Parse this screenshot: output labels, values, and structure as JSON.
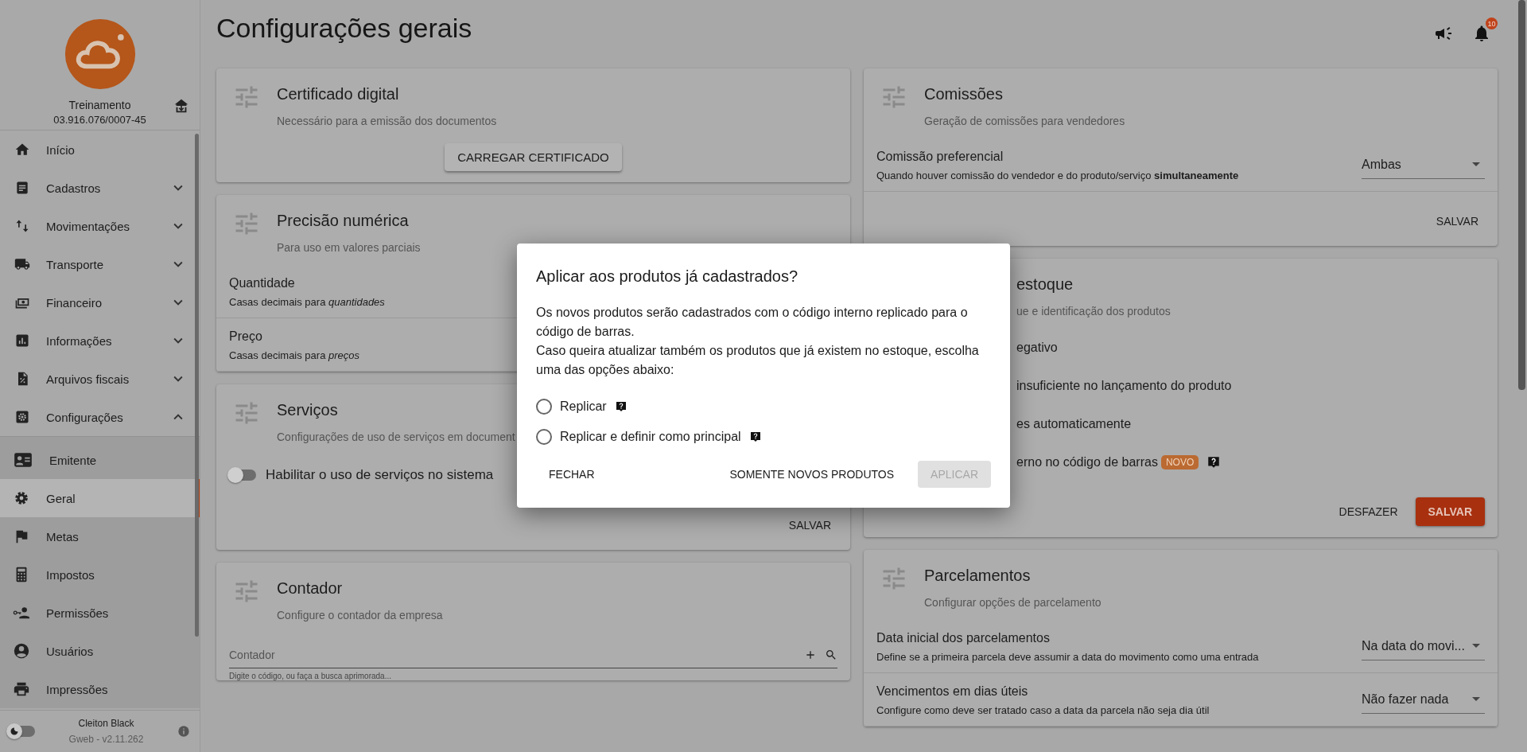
{
  "sidebar": {
    "company": {
      "name": "Treinamento",
      "id": "03.916.076/0007-45"
    },
    "items": [
      {
        "label": "Início",
        "kind": "link"
      },
      {
        "label": "Cadastros",
        "kind": "group",
        "expanded": false
      },
      {
        "label": "Movimentações",
        "kind": "group",
        "expanded": false
      },
      {
        "label": "Transporte",
        "kind": "group",
        "expanded": false
      },
      {
        "label": "Financeiro",
        "kind": "group",
        "expanded": false
      },
      {
        "label": "Informações",
        "kind": "group",
        "expanded": false
      },
      {
        "label": "Arquivos fiscais",
        "kind": "group",
        "expanded": false
      },
      {
        "label": "Configurações",
        "kind": "group",
        "expanded": true,
        "children": [
          {
            "label": "Emitente",
            "selected": false
          },
          {
            "label": "Geral",
            "selected": true
          },
          {
            "label": "Metas",
            "selected": false
          },
          {
            "label": "Impostos",
            "selected": false
          },
          {
            "label": "Permissões",
            "selected": false
          },
          {
            "label": "Usuários",
            "selected": false
          },
          {
            "label": "Impressões",
            "selected": false
          }
        ]
      }
    ],
    "footer": {
      "dark_mode": false,
      "user": "Cleiton Black",
      "version": "Gweb - v2.11.262"
    }
  },
  "header": {
    "title": "Configurações gerais",
    "notifications": "10"
  },
  "columns": [
    [
      {
        "title": "Certificado digital",
        "subtitle": "Necessário para a emissão dos documentos",
        "body": [
          {
            "kind": "button",
            "label": "CARREGAR CERTIFICADO"
          }
        ]
      },
      {
        "title": "Precisão numérica",
        "subtitle": "Para uso em valores parciais",
        "body": [
          {
            "kind": "setting",
            "label": "Quantidade",
            "description": "Casas decimais para *quantidades*"
          },
          {
            "kind": "setting",
            "label": "Preço",
            "description": "Casas decimais para *preços*"
          }
        ]
      },
      {
        "title": "Serviços",
        "subtitle": "Configurações de uso de serviços em document",
        "body": [
          {
            "kind": "switch",
            "label": "Habilitar o uso de serviços no sistema",
            "on": false
          }
        ],
        "actions": [
          {
            "label": "SALVAR",
            "kind": "text"
          }
        ]
      },
      {
        "title": "Contador",
        "subtitle": "Configure o contador da empresa",
        "body": [
          {
            "kind": "field",
            "label": "Contador",
            "hint": "Digite o código, ou faça a busca aprimorada..."
          }
        ]
      }
    ],
    [
      {
        "title": "Comissões",
        "subtitle": "Geração de comissões para vendedores",
        "body": [
          {
            "kind": "setting",
            "label": "Comissão preferencial",
            "description": "Quando houver comissão do vendedor e do produto/serviço **simultaneamente**",
            "value": "Ambas"
          }
        ],
        "actions": [
          {
            "label": "SALVAR",
            "kind": "text"
          }
        ]
      },
      {
        "title": "estoque",
        "subtitle": "ue e identificação dos produtos",
        "covered": true,
        "body": [
          {
            "kind": "fragment",
            "text": "egativo"
          },
          {
            "kind": "fragment",
            "text": "insuficiente no lançamento do produto"
          },
          {
            "kind": "fragment",
            "text": "es automaticamente"
          },
          {
            "kind": "fragment",
            "text": "erno no código de barras",
            "badge": "NOVO",
            "help": true
          }
        ],
        "actions": [
          {
            "label": "DESFAZER",
            "kind": "text"
          },
          {
            "label": "SALVAR",
            "kind": "primary"
          }
        ]
      },
      {
        "title": "Parcelamentos",
        "subtitle": "Configurar opções de parcelamento",
        "body": [
          {
            "kind": "setting",
            "label": "Data inicial dos parcelamentos",
            "description": "Define se a primeira parcela deve assumir a data do movimento como uma entrada",
            "value": "Na data do movi..."
          },
          {
            "kind": "setting",
            "label": "Vencimentos em dias úteis",
            "description": "Configure como deve ser tratado caso a data da parcela não seja dia útil",
            "value": "Não fazer nada"
          }
        ]
      }
    ]
  ],
  "modal": {
    "title": "Aplicar aos produtos já cadastrados?",
    "paragraphs": [
      "Os novos produtos serão cadastrados com o código interno replicado para o código de barras.",
      "Caso queira atualizar também os produtos que já existem no estoque, escolha uma das opções abaixo:"
    ],
    "options": [
      {
        "label": "Replicar",
        "selected": false
      },
      {
        "label": "Replicar e definir como principal",
        "selected": false
      }
    ],
    "actions": [
      {
        "label": "FECHAR",
        "kind": "text"
      },
      {
        "label": "SOMENTE NOVOS PRODUTOS",
        "kind": "text"
      },
      {
        "label": "APLICAR",
        "kind": "button",
        "disabled": true
      }
    ]
  }
}
